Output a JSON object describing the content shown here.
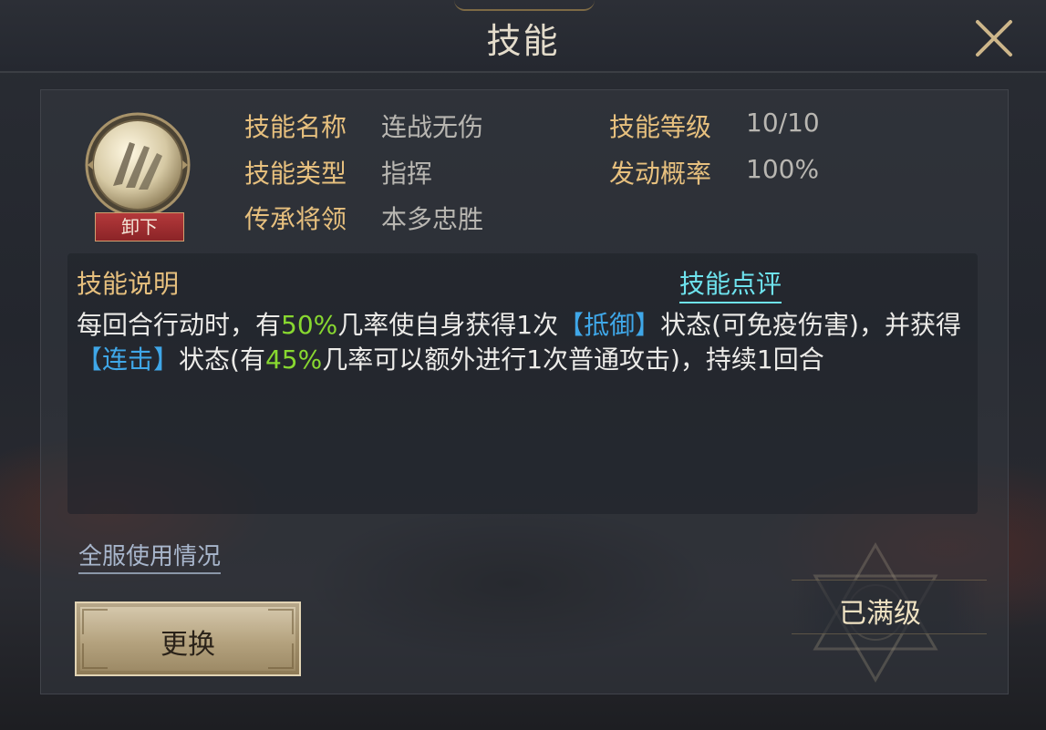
{
  "window": {
    "title": "技能"
  },
  "skill": {
    "icon_name": "claw-slash-icon",
    "unequip_label": "卸下",
    "fields": {
      "name": {
        "label": "技能名称",
        "value": "连战无伤"
      },
      "level": {
        "label": "技能等级",
        "value": "10/10"
      },
      "type": {
        "label": "技能类型",
        "value": "指挥"
      },
      "chance": {
        "label": "发动概率",
        "value": "100%"
      },
      "inherit": {
        "label": "传承将领",
        "value": "本多忠胜"
      }
    }
  },
  "description": {
    "title": "技能说明",
    "review_link": "技能点评",
    "segments": [
      {
        "text": "每回合行动时，有",
        "style": "normal"
      },
      {
        "text": "50%",
        "style": "green"
      },
      {
        "text": "几率使自身获得1次",
        "style": "normal"
      },
      {
        "text": "【抵御】",
        "style": "blue"
      },
      {
        "text": "状态(可免疫伤害)，并获得",
        "style": "normal"
      },
      {
        "text": "【连击】",
        "style": "blue"
      },
      {
        "text": "状态(有",
        "style": "normal"
      },
      {
        "text": "45%",
        "style": "green"
      },
      {
        "text": "几率可以额外进行1次普通攻击)，持续1回合",
        "style": "normal"
      }
    ]
  },
  "footer": {
    "usage_link": "全服使用情况",
    "change_button": "更换",
    "max_level_label": "已满级"
  },
  "colors": {
    "label_gold": "#e7c07e",
    "highlight_green": "#88d830",
    "highlight_blue": "#3fa7e8",
    "link_cyan": "#6ee3ee",
    "unequip_red": "#b4393b"
  }
}
